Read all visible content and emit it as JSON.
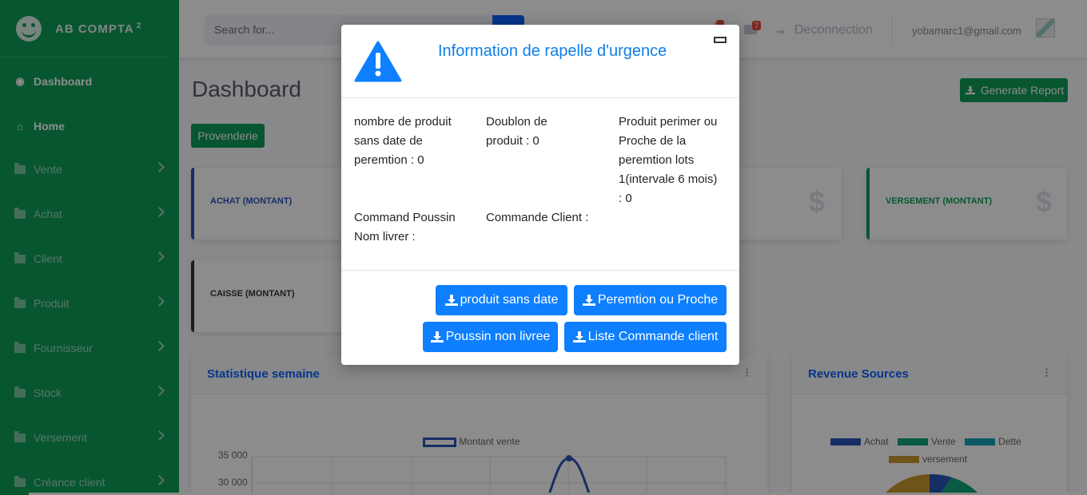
{
  "sidebar": {
    "brand": "AB COMPTA",
    "brand_sup": "2",
    "items": [
      {
        "label": "Dashboard",
        "icon": "tachometer-icon"
      },
      {
        "label": "Home",
        "icon": "home-icon"
      },
      {
        "label": "Vente",
        "icon": "folder-icon"
      },
      {
        "label": "Achat",
        "icon": "folder-icon"
      },
      {
        "label": "Client",
        "icon": "folder-icon"
      },
      {
        "label": "Produit",
        "icon": "folder-icon"
      },
      {
        "label": "Fournisseur",
        "icon": "folder-icon"
      },
      {
        "label": "Stock",
        "icon": "folder-icon"
      },
      {
        "label": "Versement",
        "icon": "folder-icon"
      },
      {
        "label": "Créance client",
        "icon": "folder-icon"
      }
    ]
  },
  "topbar": {
    "search_placeholder": "Search for...",
    "alerts_count": "",
    "messages_count": "7",
    "logout_label": "Deconnection",
    "user_email": "yobamarc1@gmail.com"
  },
  "main": {
    "title": "Dashboard",
    "generate_report": "Generate Report",
    "provenderie": "Provenderie",
    "cards": {
      "achat": "ACHAT (MONTANT)",
      "versement": "VERSEMENT (MONTANT)",
      "caisse": "CAISSE (MONTANT)",
      "dollar": "$"
    },
    "stat_panel_title": "Statistique semaine",
    "revenue_panel_title": "Revenue Sources",
    "line_legend": "Montant vente",
    "y_ticks": [
      "35 000",
      "30 000"
    ],
    "pie_legend": [
      "Achat",
      "Vente",
      "Dette",
      "versement"
    ]
  },
  "modal": {
    "title": "Information de rapelle d'urgence",
    "items": {
      "no_date": [
        "nombre de produit",
        "sans date de",
        "peremtion : 0"
      ],
      "doublon": [
        "Doublon de",
        "produit : 0"
      ],
      "perime": [
        "Produit perimer ou",
        "Proche de la",
        "peremtion lots",
        "1(intervale 6 mois)",
        ": 0"
      ],
      "poussin": [
        "Command Poussin",
        "Nom livrer :"
      ],
      "commande": [
        "Commande Client :"
      ]
    },
    "buttons": {
      "no_date": "produit sans date",
      "peremtion": "Peremtion ou Proche",
      "poussin": "Poussin non livree",
      "commande": "Liste Commande client"
    }
  },
  "chart_data": {
    "type": "line",
    "series": [
      {
        "name": "Montant vente",
        "values": [
          35000
        ]
      }
    ],
    "y_ticks": [
      35000,
      30000
    ]
  },
  "colors": {
    "sidebar": "#0f9d58",
    "primary": "#0d7fff",
    "achat_pie": "#2a55b8",
    "vente_pie": "#11a57a",
    "dette_pie": "#17a2b8",
    "versement_pie": "#c99a2e"
  }
}
